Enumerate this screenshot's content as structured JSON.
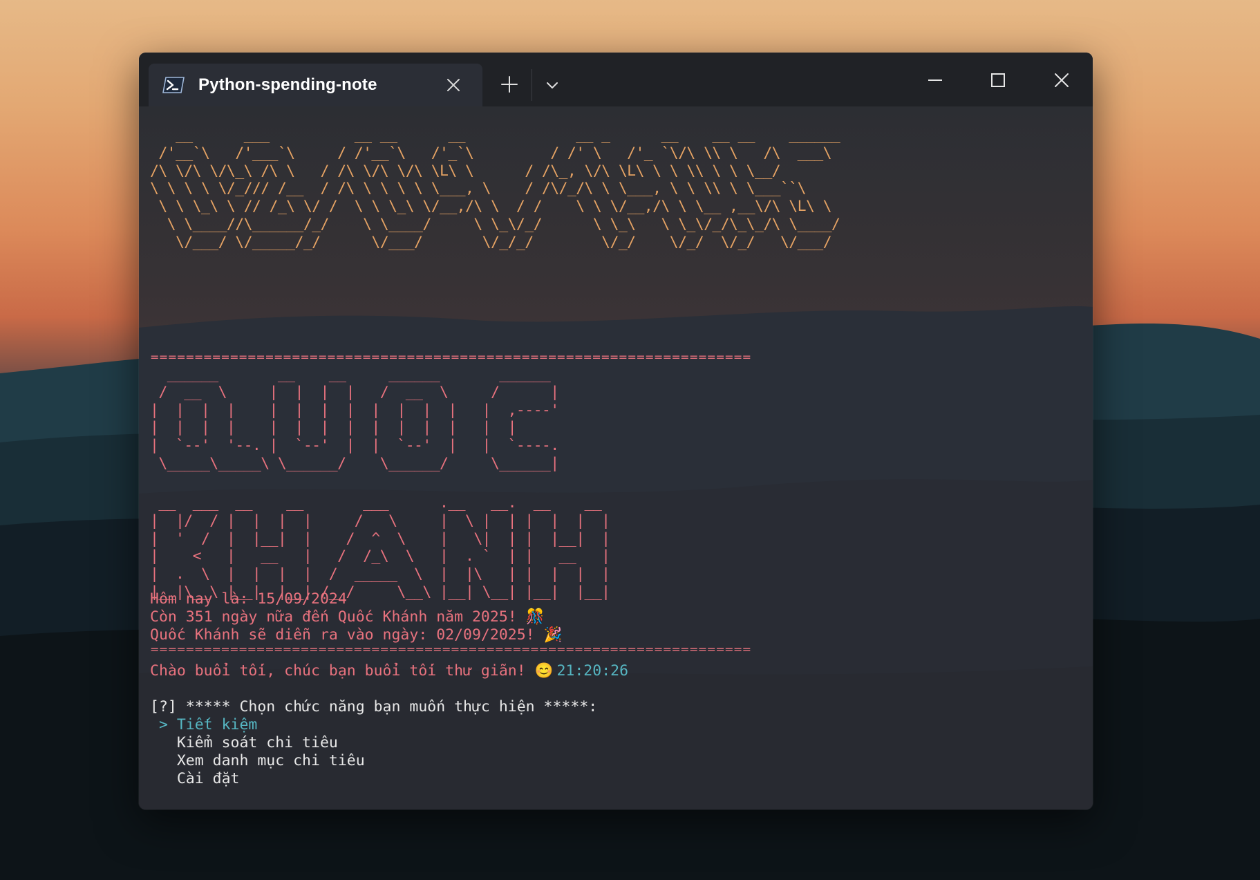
{
  "window": {
    "tab_title": "Python-spending-note",
    "tab_icon": "powershell-icon"
  },
  "ascii_art": {
    "vanny": [
      "   __      ___          __ __      __             __ _      __    __ __    ______",
      " /'__`\\   /'___`\\     / /'__`\\   /'_`\\         / /' \\   /'_ `\\/\\ \\\\ \\   /\\  ___\\",
      "/\\ \\/\\ \\/\\_\\ /\\ \\   / /\\ \\/\\ \\/\\ \\L\\ \\      / /\\_, \\/\\ \\L\\ \\ \\ \\\\ \\ \\ \\__/",
      "\\ \\ \\ \\ \\/_/// /__  / /\\ \\ \\ \\ \\ \\___, \\    / /\\/_/\\ \\ \\___, \\ \\ \\\\ \\ \\___``\\",
      " \\ \\ \\_\\ \\ // /_\\ \\/ /  \\ \\ \\_\\ \\/__,/\\ \\  / /    \\ \\ \\/__,/\\ \\ \\__ ,__\\/\\ \\L\\ \\",
      "  \\ \\____//\\______/_/    \\ \\____/     \\ \\_\\/_/      \\ \\_\\   \\ \\_\\/_/\\_\\_/\\ \\____/",
      "   \\/___/ \\/_____/_/      \\/___/       \\/_/_/        \\/_/    \\/_/  \\/_/   \\/___/"
    ],
    "separator": "====================================================================",
    "quoc": [
      "  ______       __    __     ______       ______",
      " /  __  \\     |  |  |  |   /  __  \\     /      |",
      "|  |  |  |    |  |  |  |  |  |  |  |   |  ,----'",
      "|  |  |  |    |  |  |  |  |  |  |  |   |  |",
      "|  `--'  '--. |  `--'  |  |  `--'  |   |  `----.",
      " \\_____\\_____\\ \\______/    \\______/     \\______|"
    ],
    "khanh": [
      " __  ___  __    __       ___      .__   __.  __    __",
      "|  |/  / |  |  |  |     /   \\     |  \\ |  | |  |  |  |",
      "|  '  /  |  |__|  |    /  ^  \\    |   \\|  | |  |__|  |",
      "|    <   |   __   |   /  /_\\  \\   |  . `  | |   __   |",
      "|  .  \\  |  |  |  |  /  _____  \\  |  |\\   | |  |  |  |",
      "|__|\\__\\ |__|  |__| /__/     \\__\\ |__| \\__| |__|  |__|"
    ]
  },
  "info": {
    "today": "Hôm nay là: 15/09/2024",
    "days_left": "Còn 351 ngày nữa đến Quốc Khánh năm 2025! 🎊",
    "event_date": "Quốc Khánh sẽ diễn ra vào ngày: 02/09/2025! 🎉",
    "greeting": "Chào buổi tối, chúc bạn buổi tối thư giãn! 😊",
    "clock": "21:20:26"
  },
  "menu": {
    "prompt": "[?] ***** Chọn chức năng bạn muốn thực hiện *****:",
    "pointer": " > ",
    "items": [
      {
        "label": "Tiết kiệm",
        "selected": true
      },
      {
        "label": "Kiểm soát chi tiêu",
        "selected": false
      },
      {
        "label": "Xem danh mục chi tiêu",
        "selected": false
      },
      {
        "label": "Cài đặt",
        "selected": false
      }
    ]
  },
  "colors": {
    "accent_pink": "#e8727e",
    "accent_orange": "#e6a364",
    "accent_cyan": "#56b6c2",
    "text": "#e7e7e7"
  }
}
